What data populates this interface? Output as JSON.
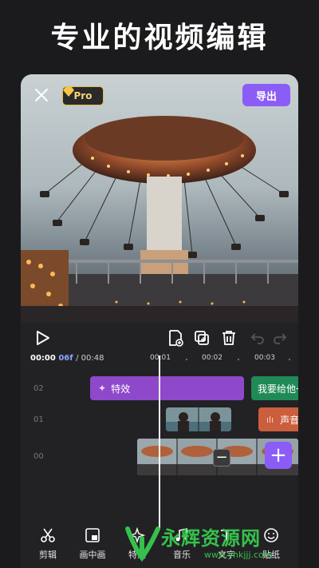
{
  "headline": "专业的视频编辑",
  "header": {
    "pro_label": "Pro",
    "export_label": "导出"
  },
  "timeline": {
    "current_time": "00:00",
    "current_frames": "06f",
    "total_time": "/ 00:48",
    "ticks": [
      "00:01",
      "00:02",
      "00:03"
    ],
    "tracks": [
      "02",
      "01",
      "00"
    ],
    "effect_clip_label": "特效",
    "text_clip_label": "我要给他一",
    "audio_clip_label": "声音"
  },
  "toolbar": {
    "items": [
      "剪辑",
      "画中画",
      "特效",
      "音乐",
      "文字",
      "贴纸"
    ]
  },
  "watermark": {
    "title": "永辉资源网",
    "url": "www.yhkjjj.com"
  },
  "colors": {
    "accent": "#8b5cf6",
    "effect": "#8d49c9",
    "text_clip": "#1f8a55",
    "audio": "#cb5e3c",
    "watermark": "#35c14c"
  }
}
